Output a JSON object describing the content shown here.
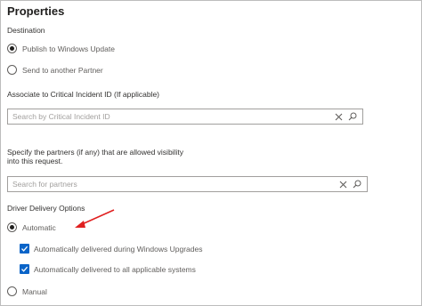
{
  "panel": {
    "title": "Properties"
  },
  "destination": {
    "label": "Destination",
    "options": [
      {
        "label": "Publish to Windows Update",
        "checked": true
      },
      {
        "label": "Send to another Partner",
        "checked": false
      }
    ]
  },
  "incident": {
    "label": "Associate to Critical Incident ID (If applicable)",
    "placeholder": "Search by Critical Incident ID"
  },
  "partners": {
    "label_line1": "Specify the partners (if any) that are allowed visibility",
    "label_line2": "into this request.",
    "placeholder": "Search for partners"
  },
  "driver_delivery": {
    "label": "Driver Delivery Options",
    "automatic": {
      "label": "Automatic",
      "checked": true
    },
    "sub_options": [
      {
        "label": "Automatically delivered during Windows Upgrades",
        "checked": true
      },
      {
        "label": "Automatically delivered to all applicable systems",
        "checked": true
      }
    ],
    "manual": {
      "label": "Manual",
      "checked": false
    }
  },
  "colors": {
    "checkbox": "#0a64c8",
    "arrow": "#e02020"
  },
  "icons": {
    "clear": "close-icon",
    "search": "search-icon",
    "annotation": "red-arrow-icon"
  }
}
